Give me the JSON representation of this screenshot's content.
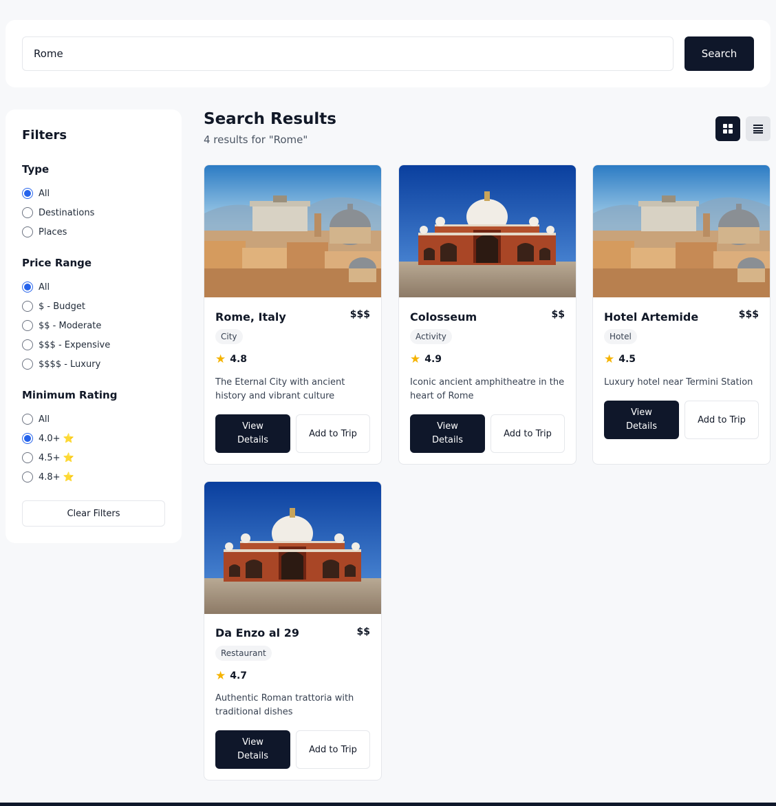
{
  "search": {
    "value": "Rome",
    "button_label": "Search"
  },
  "filters": {
    "title": "Filters",
    "type": {
      "title": "Type",
      "options": [
        "All",
        "Destinations",
        "Places"
      ],
      "selected": "All"
    },
    "price": {
      "title": "Price Range",
      "options": [
        "All",
        "$ - Budget",
        "$$ - Moderate",
        "$$$ - Expensive",
        "$$$$ - Luxury"
      ],
      "selected": "All"
    },
    "rating": {
      "title": "Minimum Rating",
      "options": [
        "All",
        "4.0+ ⭐",
        "4.5+ ⭐",
        "4.8+ ⭐"
      ],
      "selected": "4.0+ ⭐"
    },
    "clear_label": "Clear Filters"
  },
  "results": {
    "title": "Search Results",
    "subtitle": "4 results for \"Rome\"",
    "view_modes": [
      "grid-icon",
      "list-icon"
    ],
    "active_view": "grid",
    "items": [
      {
        "name": "Rome, Italy",
        "price": "$$$",
        "category": "City",
        "rating": "4.8",
        "description": "The Eternal City with ancient history and vibrant culture",
        "image": "rome-skyline",
        "primary_label": "View Details",
        "secondary_label": "Add to Trip"
      },
      {
        "name": "Colosseum",
        "price": "$$",
        "category": "Activity",
        "rating": "4.9",
        "description": "Iconic ancient amphitheatre in the heart of Rome",
        "image": "red-sandstone-monument",
        "primary_label": "View Details",
        "secondary_label": "Add to Trip"
      },
      {
        "name": "Hotel Artemide",
        "price": "$$$",
        "category": "Hotel",
        "rating": "4.5",
        "description": "Luxury hotel near Termini Station",
        "image": "rome-skyline",
        "primary_label": "View Details",
        "secondary_label": "Add to Trip"
      },
      {
        "name": "Da Enzo al 29",
        "price": "$$",
        "category": "Restaurant",
        "rating": "4.7",
        "description": "Authentic Roman trattoria with traditional dishes",
        "image": "red-sandstone-monument",
        "primary_label": "View Details",
        "secondary_label": "Add to Trip"
      }
    ]
  },
  "colors": {
    "primary": "#0f172a",
    "accent": "#2563eb",
    "star": "#f5b301",
    "background": "#f7f8fa"
  }
}
